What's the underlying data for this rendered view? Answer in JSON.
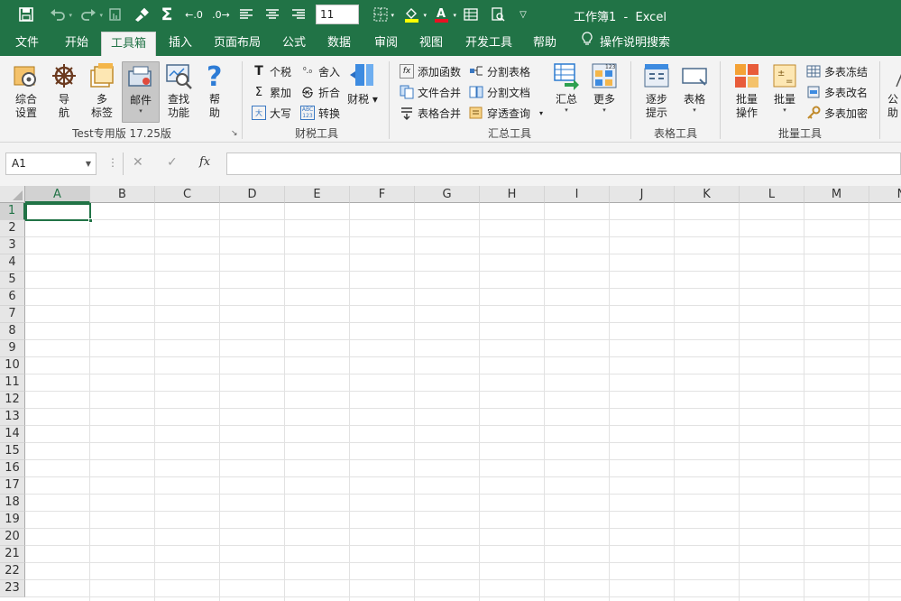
{
  "window_title": "工作簿1  -  Excel",
  "quick_access": {
    "font_size": "11",
    "icons": [
      "save-icon",
      "undo-icon",
      "redo-icon",
      "touch-mode-icon",
      "format-painter-icon",
      "autosum-icon",
      "increase-decimal-icon",
      "decrease-decimal-icon",
      "align-left-icon",
      "align-center-icon",
      "align-right-icon",
      "borders-icon",
      "fill-color-icon",
      "font-color-icon",
      "cell-styles-icon",
      "print-preview-icon",
      "customize-quick-access-icon"
    ]
  },
  "menu": {
    "tabs": [
      "文件",
      "开始",
      "工具箱",
      "插入",
      "页面布局",
      "公式",
      "数据",
      "审阅",
      "视图",
      "开发工具",
      "帮助"
    ],
    "active_tab": "工具箱",
    "tell_me": "操作说明搜索"
  },
  "ribbon": {
    "group1": {
      "buttons": [
        "综合\n设置",
        "导\n航",
        "多\n标签",
        "邮件",
        "查找\n功能",
        "帮\n助"
      ],
      "label": "Test专用版 17.25版"
    },
    "group2": {
      "small": [
        "个税",
        "累加",
        "大写",
        "舍入",
        "折合",
        "转换"
      ],
      "big": "财税",
      "label": "财税工具"
    },
    "group3": {
      "small": [
        "添加函数",
        "文件合并",
        "表格合并",
        "分割表格",
        "分割文档",
        "穿透查询"
      ],
      "big": [
        "汇总",
        "更多"
      ],
      "label": "汇总工具"
    },
    "group4": {
      "big": [
        "逐步\n提示",
        "表格"
      ],
      "label": "表格工具"
    },
    "group5": {
      "big": [
        "批量\n操作",
        "批量"
      ],
      "small": [
        "多表冻结",
        "多表改名",
        "多表加密"
      ],
      "label": "批量工具"
    },
    "group6_partial": "公\n助"
  },
  "formula_bar": {
    "name_box": "A1",
    "cancel": "✕",
    "enter": "✓",
    "fx": "fx",
    "formula": ""
  },
  "grid": {
    "columns": [
      "A",
      "B",
      "C",
      "D",
      "E",
      "F",
      "G",
      "H",
      "I",
      "J",
      "K",
      "L",
      "M",
      "N"
    ],
    "rows": [
      "1",
      "2",
      "3",
      "4",
      "5",
      "6",
      "7",
      "8",
      "9",
      "10",
      "11",
      "12",
      "13",
      "14",
      "15",
      "16",
      "17",
      "18",
      "19",
      "20",
      "21",
      "22",
      "23"
    ],
    "active_cell": "A1"
  },
  "colors": {
    "brand": "#217346",
    "ribbon_bg": "#f3f3f3",
    "header_bg": "#e6e6e6"
  }
}
